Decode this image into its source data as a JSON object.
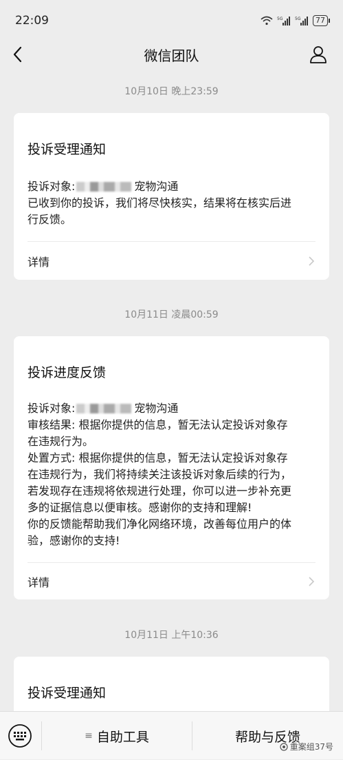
{
  "status_bar": {
    "time": "22:09",
    "battery": "77"
  },
  "header": {
    "title": "微信团队"
  },
  "messages": [
    {
      "timestamp": "10月10日 晚上23:59",
      "title": "投诉受理通知",
      "target_label": "投诉对象:",
      "target_suffix": "宠物沟通",
      "lines": [
        "已收到你的投诉，我们将尽快核实，结果将在核实后进",
        "行反馈。"
      ],
      "detail_label": "详情"
    },
    {
      "timestamp": "10月11日 凌晨00:59",
      "title": "投诉进度反馈",
      "target_label": "投诉对象:",
      "target_suffix": "宠物沟通",
      "lines": [
        "审核结果: 根据你提供的信息，暂无法认定投诉对象存",
        "在违规行为。",
        "处置方式: 根据你提供的信息，暂无法认定投诉对象存",
        "在违规行为，我们将持续关注该投诉对象后续的行为，",
        "若发现存在违规将依规进行处理，你可以进一步补充更",
        "多的证据信息以便审核。感谢你的支持和理解!",
        "你的反馈能帮助我们净化网络环境，改善每位用户的体",
        "验，感谢你的支持!"
      ],
      "detail_label": "详情"
    },
    {
      "timestamp": "10月11日 上午10:36",
      "title": "投诉受理通知"
    }
  ],
  "bottom_bar": {
    "menu1_icon": "≡",
    "menu1_label": "自助工具",
    "menu2_label": "帮助与反馈",
    "watermark": "重案组37号"
  }
}
